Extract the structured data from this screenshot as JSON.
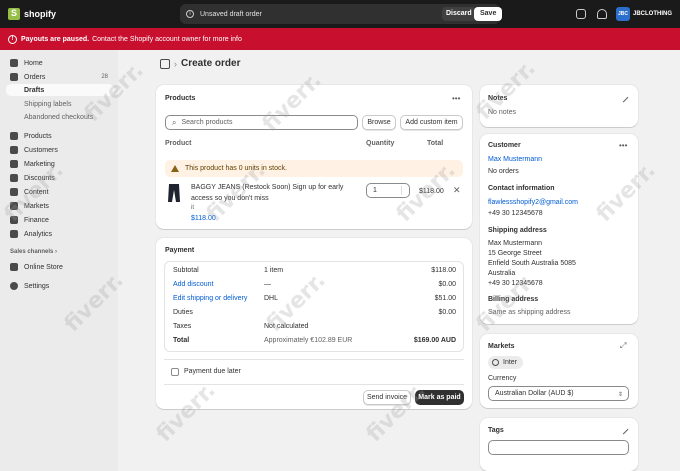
{
  "topbar": {
    "brand": "shopify",
    "unsaved_text": "Unsaved draft order",
    "discard_label": "Discard",
    "save_label": "Save",
    "store_initials": "JBC",
    "store_name": "JBCLOTHING"
  },
  "banner": {
    "bold": "Payouts are paused.",
    "text": "Contact the Shopify account owner for more info",
    "color": "#c8102e"
  },
  "sidebar": {
    "items": [
      {
        "label": "Home",
        "icon": "home-icon"
      },
      {
        "label": "Orders",
        "icon": "orders-icon",
        "badge": "28"
      },
      {
        "label": "Drafts"
      },
      {
        "label": "Shipping labels"
      },
      {
        "label": "Abandoned checkouts"
      },
      {
        "label": "Products",
        "icon": "products-icon"
      },
      {
        "label": "Customers",
        "icon": "customers-icon"
      },
      {
        "label": "Marketing",
        "icon": "marketing-icon"
      },
      {
        "label": "Discounts",
        "icon": "discounts-icon"
      },
      {
        "label": "Content",
        "icon": "content-icon"
      },
      {
        "label": "Markets",
        "icon": "markets-icon"
      },
      {
        "label": "Finance",
        "icon": "finance-icon"
      },
      {
        "label": "Analytics",
        "icon": "analytics-icon"
      }
    ],
    "sales_channels_label": "Sales channels",
    "online_store_label": "Online Store",
    "settings_label": "Settings"
  },
  "page": {
    "title": "Create order"
  },
  "products": {
    "title": "Products",
    "search_placeholder": "Search products",
    "browse_label": "Browse",
    "add_custom_label": "Add custom item",
    "col_product": "Product",
    "col_quantity": "Quantity",
    "col_total": "Total",
    "warning": "This product has 0 units in stock.",
    "item_name_line1": "BAGGY JEANS (Restock Soon) Sign up for early",
    "item_name_line2": "access so you don't miss",
    "item_variant": "it",
    "item_price": "$118.00",
    "item_qty": "1",
    "item_total": "$118.00"
  },
  "payment": {
    "title": "Payment",
    "rows": [
      {
        "label": "Subtotal",
        "detail": "1 item",
        "value": "$118.00"
      },
      {
        "label": "Add discount",
        "detail": "—",
        "value": "$0.00"
      },
      {
        "label": "Edit shipping or delivery",
        "detail": "DHL",
        "value": "$51.00"
      },
      {
        "label": "Duties",
        "detail": "",
        "value": "$0.00"
      },
      {
        "label": "Taxes",
        "detail": "Not calculated",
        "value": ""
      },
      {
        "label": "Total",
        "detail": "Approximately €102.89 EUR",
        "value": "$169.00 AUD"
      }
    ],
    "payment_due_label": "Payment due later",
    "send_invoice_label": "Send invoice",
    "mark_paid_label": "Mark as paid"
  },
  "notes": {
    "title": "Notes",
    "text": "No notes"
  },
  "customer": {
    "title": "Customer",
    "name": "Max Mustermann",
    "orders": "No orders",
    "contact_title": "Contact information",
    "email": "flawlessshopify2@gmail.com",
    "phone": "+49 30 12345678",
    "shipping_title": "Shipping address",
    "shipping_lines": [
      "Max Mustermann",
      "15 George Street",
      "Enfield South Australia 5085",
      "Australia",
      "+49 30 12345678"
    ],
    "billing_title": "Billing address",
    "billing_text": "Same as shipping address"
  },
  "markets": {
    "title": "Markets",
    "market": "Inter",
    "currency_label": "Currency",
    "currency_value": "Australian Dollar (AUD $)"
  },
  "tags": {
    "title": "Tags"
  },
  "watermark": "fiverr."
}
